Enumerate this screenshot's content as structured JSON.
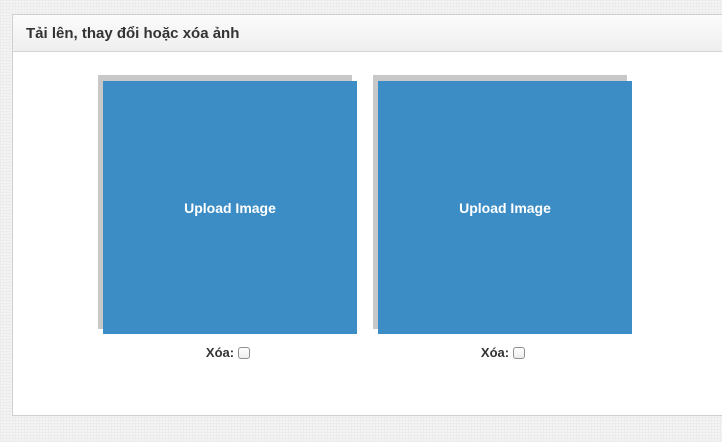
{
  "panel": {
    "title": "Tải lên, thay đổi hoặc xóa ảnh"
  },
  "slots": [
    {
      "upload_label": "Upload Image",
      "delete_label": "Xóa:",
      "delete_checked": false
    },
    {
      "upload_label": "Upload Image",
      "delete_label": "Xóa:",
      "delete_checked": false
    }
  ],
  "colors": {
    "upload_box": "#3c8dc5",
    "upload_text": "#ffffff",
    "panel_border": "#cfcfcf"
  }
}
